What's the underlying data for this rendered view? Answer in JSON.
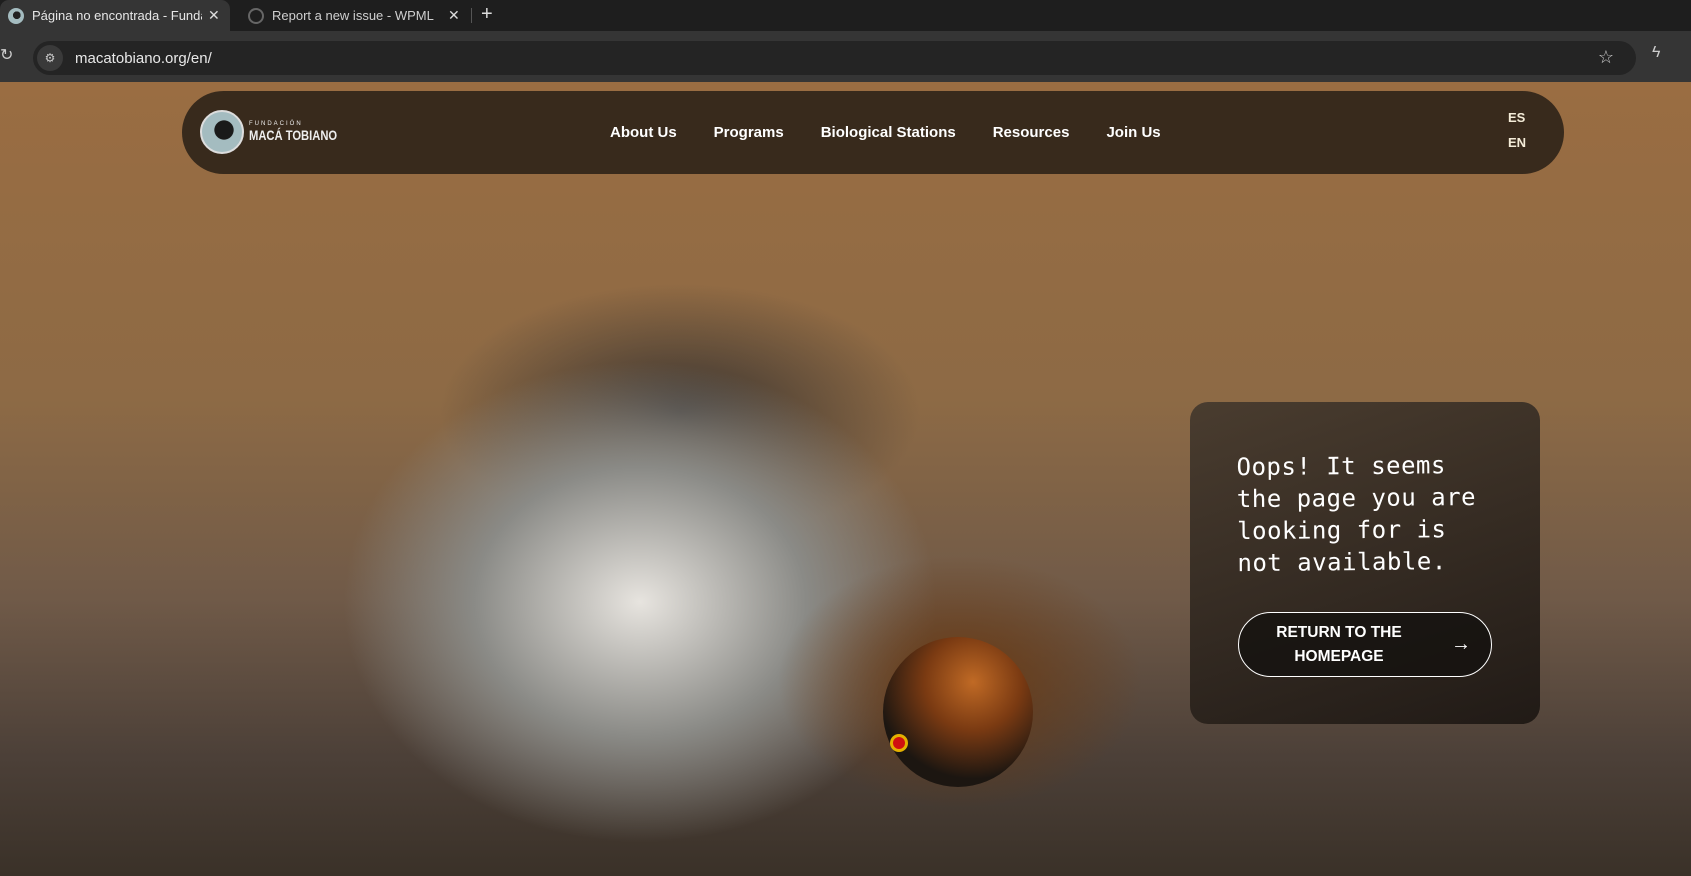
{
  "browser": {
    "tabs": [
      {
        "title": "Página no encontrada - Fundación Macá Tobiano",
        "active": true
      },
      {
        "title": "Report a new issue - WPML",
        "active": false
      }
    ],
    "url": "macatobiano.org/en/",
    "icons": [
      "reload-icon",
      "site-settings-icon",
      "bookmark-star-icon",
      "extension-icon",
      "new-tab-icon",
      "close-icon"
    ]
  },
  "site": {
    "logo": {
      "line1": "FUNDACIÓN",
      "line2": "MACÁ TOBIANO"
    },
    "nav": [
      "About Us",
      "Programs",
      "Biological Stations",
      "Resources",
      "Join Us"
    ],
    "languages": [
      "ES",
      "EN"
    ],
    "error_message": "Oops! It seems the page you are looking for is not available.",
    "return_button": {
      "line1": "RETURN TO THE",
      "line2": "HOMEPAGE",
      "icon": "arrow-right-icon"
    },
    "colors": {
      "nav_bg": "#382a1c",
      "card_bg": "#2a221c",
      "text": "#ffffff"
    }
  }
}
